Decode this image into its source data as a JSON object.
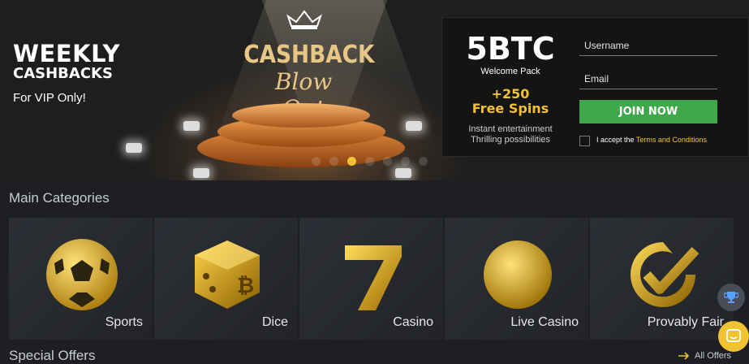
{
  "hero": {
    "title": "WEEKLY",
    "subtitle": "CASHBACKS",
    "vip_text": "For VIP Only!",
    "promo_title": "CASHBACK",
    "promo_script": "Blow Out",
    "active_slide": 3,
    "slide_count": 7
  },
  "signup": {
    "amount": "5BTC",
    "welcome": "Welcome Pack",
    "spins_line1": "+250",
    "spins_line2": "Free Spins",
    "tagline1": "Instant entertainment",
    "tagline2": "Thrilling possibilities",
    "username_placeholder": "Username",
    "email_placeholder": "Email",
    "join_label": "JOIN NOW",
    "terms_prefix": "I accept the",
    "terms_link": "Terms and Conditions"
  },
  "main": {
    "categories_title": "Main Categories",
    "categories": [
      {
        "label": "Sports",
        "icon": "soccer-ball-icon"
      },
      {
        "label": "Dice",
        "icon": "bitcoin-dice-icon"
      },
      {
        "label": "Casino",
        "icon": "lucky-seven-icon"
      },
      {
        "label": "Live Casino",
        "icon": "gold-sphere-icon"
      },
      {
        "label": "Provably Fair",
        "icon": "checkmark-badge-icon"
      }
    ],
    "offers_title": "Special Offers",
    "all_offers": "All Offers"
  },
  "colors": {
    "accent": "#f1c232",
    "join": "#3ea84a",
    "bg": "#1d1f24"
  }
}
